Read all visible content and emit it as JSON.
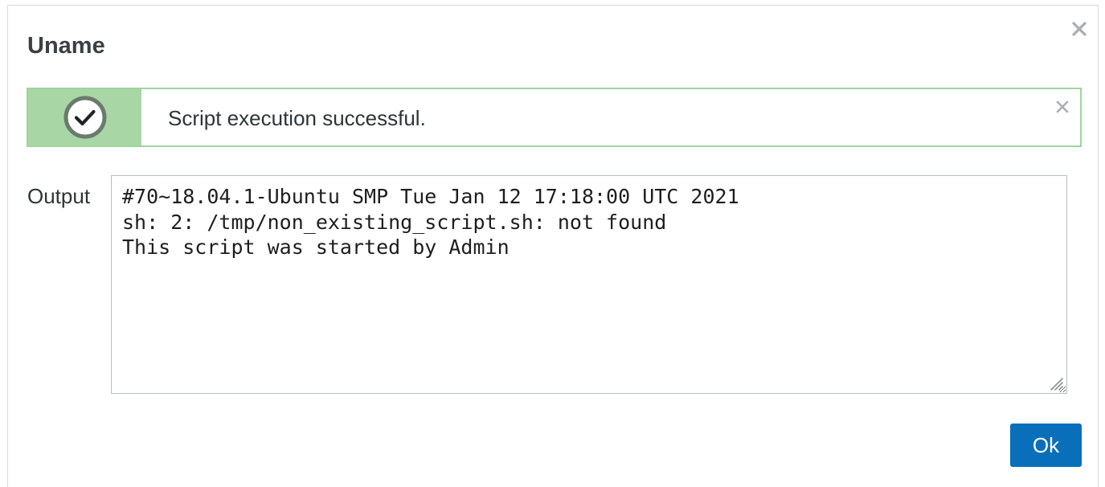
{
  "dialog": {
    "title": "Uname",
    "close_icon": "close-icon"
  },
  "message": {
    "text": "Script execution successful.",
    "status_icon": "check-circle-icon",
    "close_icon": "close-icon",
    "colors": {
      "icon_background": "#a8d6a4",
      "border": "#9fd49f"
    }
  },
  "output": {
    "label": "Output",
    "value": "#70~18.04.1-Ubuntu SMP Tue Jan 12 17:18:00 UTC 2021\nsh: 2: /tmp/non_existing_script.sh: not found\nThis script was started by Admin"
  },
  "footer": {
    "ok_label": "Ok",
    "ok_color": "#0a6fba"
  }
}
